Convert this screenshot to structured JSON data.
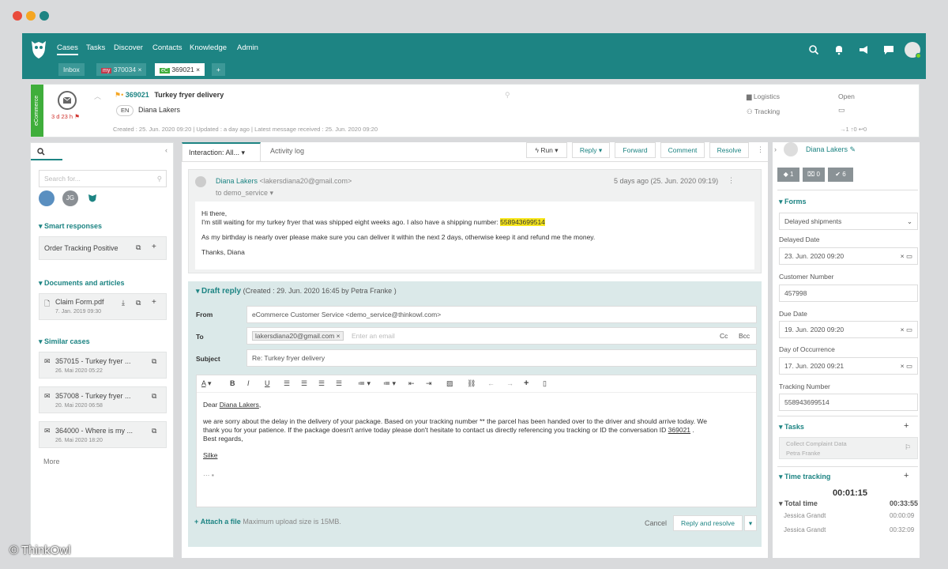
{
  "window": {
    "controls": [
      {
        "color": "#e94b3c"
      },
      {
        "color": "#f5a623"
      },
      {
        "color": "#1d8483"
      }
    ]
  },
  "nav": {
    "items": [
      "Cases",
      "Tasks",
      "Discover",
      "Contacts",
      "Knowledge",
      "Admin"
    ],
    "active": "Cases"
  },
  "tabs": {
    "inbox": "Inbox",
    "tab1": {
      "badge": "my",
      "number": "370034"
    },
    "tab2": {
      "badge": "eC",
      "number": "369021"
    },
    "add": "+"
  },
  "case": {
    "channel": "eCommerce",
    "timer": "3 d 23 h",
    "number": "369021",
    "title": "Turkey fryer delivery",
    "language": "EN",
    "contact": "Diana Lakers",
    "created": "Created : 25. Jun. 2020 09:20",
    "updated": "Updated : a day ago",
    "latest": "Latest message received : 25. Jun. 2020 09:20",
    "category1": "Logistics",
    "category2": "Tracking",
    "status": "Open",
    "counters": "→1  ↑0  ↩0"
  },
  "left": {
    "search_placeholder": "Search for...",
    "avatar_initials": "JG",
    "smart_title": "Smart responses",
    "smart_item": "Order Tracking Positive",
    "docs_title": "Documents and articles",
    "doc_name": "Claim Form.pdf",
    "doc_date": "7. Jan. 2019 09:30",
    "similar_title": "Similar cases",
    "similar": [
      {
        "title": "357015 - Turkey fryer ...",
        "date": "26. Mai 2020 05:22"
      },
      {
        "title": "357008 - Turkey fryer ...",
        "date": "20. Mai 2020 06:58"
      },
      {
        "title": "364000 - Where is my ...",
        "date": "26. Mai 2020 18:20"
      }
    ],
    "more": "More"
  },
  "center": {
    "tab_interaction": "Interaction: All...",
    "tab_activity": "Activity log",
    "run": "Run",
    "reply": "Reply",
    "forward": "Forward",
    "comment": "Comment",
    "resolve": "Resolve"
  },
  "message": {
    "sender": "Diana Lakers",
    "email": "<lakersdiana20@gmail.com>",
    "to": "to demo_service",
    "time": "5 days ago (25. Jun. 2020 09:19)",
    "greeting": "Hi there,",
    "line1": "I'm still waiting for my turkey fryer that was shipped eight weeks ago. I also have a shipping number: ",
    "tracking": "558943699514",
    "line2": "As my birthday is nearly over please make sure you can deliver it within the next 2 days, otherwise keep it and refund me the money.",
    "signoff": "Thanks, Diana"
  },
  "draft": {
    "title": "Draft reply",
    "info": "(Created : 29. Jun. 2020 16:45 by Petra Franke )",
    "from_label": "From",
    "from_value": "eCommerce Customer Service <demo_service@thinkowl.com>",
    "to_label": "To",
    "to_chip": "lakersdiana20@gmail.com",
    "to_placeholder": "Enter an email",
    "cc": "Cc",
    "bcc": "Bcc",
    "subject_label": "Subject",
    "subject_value": "Re: Turkey fryer delivery",
    "body_dear": "Dear ",
    "body_name": "Diana Lakers",
    "body_line1": "we are sorry about the delay in the delivery of your package. Based on your tracking number ** the parcel has been handed over to the driver and should arrive today. We",
    "body_line2a": "thank you for your patience. If the package doesn't arrive today please don't hesitate to contact us directly referencing you tracking or ID the conversation ID ",
    "body_id": "369021",
    "body_line3": "Best regards,",
    "body_sig": "Silke",
    "attach": "Attach a file",
    "attach_info": "Maximum upload size is 15MB.",
    "cancel": "Cancel",
    "reply_resolve": "Reply and resolve"
  },
  "right": {
    "contact": "Diana Lakers",
    "count1": "1",
    "count2": "0",
    "count3": "6",
    "forms_title": "Forms",
    "form_select": "Delayed shipments",
    "fields": [
      {
        "label": "Delayed Date",
        "value": "23. Jun. 2020 09:20"
      },
      {
        "label": "Customer Number",
        "value": "457998"
      },
      {
        "label": "Due Date",
        "value": "19. Jun. 2020 09:20"
      },
      {
        "label": "Day of Occurrence",
        "value": "17. Jun. 2020 09:21"
      },
      {
        "label": "Tracking Number",
        "value": "558943699514"
      }
    ],
    "tasks_title": "Tasks",
    "task_line1": "Collect Complaint Data",
    "task_line2": "Petra Franke",
    "time_title": "Time tracking",
    "timer": "00:01:15",
    "total_label": "Total time",
    "total_value": "00:33:55",
    "entries": [
      {
        "name": "Jessica Grandt",
        "value": "00:00:09"
      },
      {
        "name": "Jessica Grandt",
        "value": "00:32:09"
      }
    ]
  },
  "watermark": "© ThinkOwl"
}
